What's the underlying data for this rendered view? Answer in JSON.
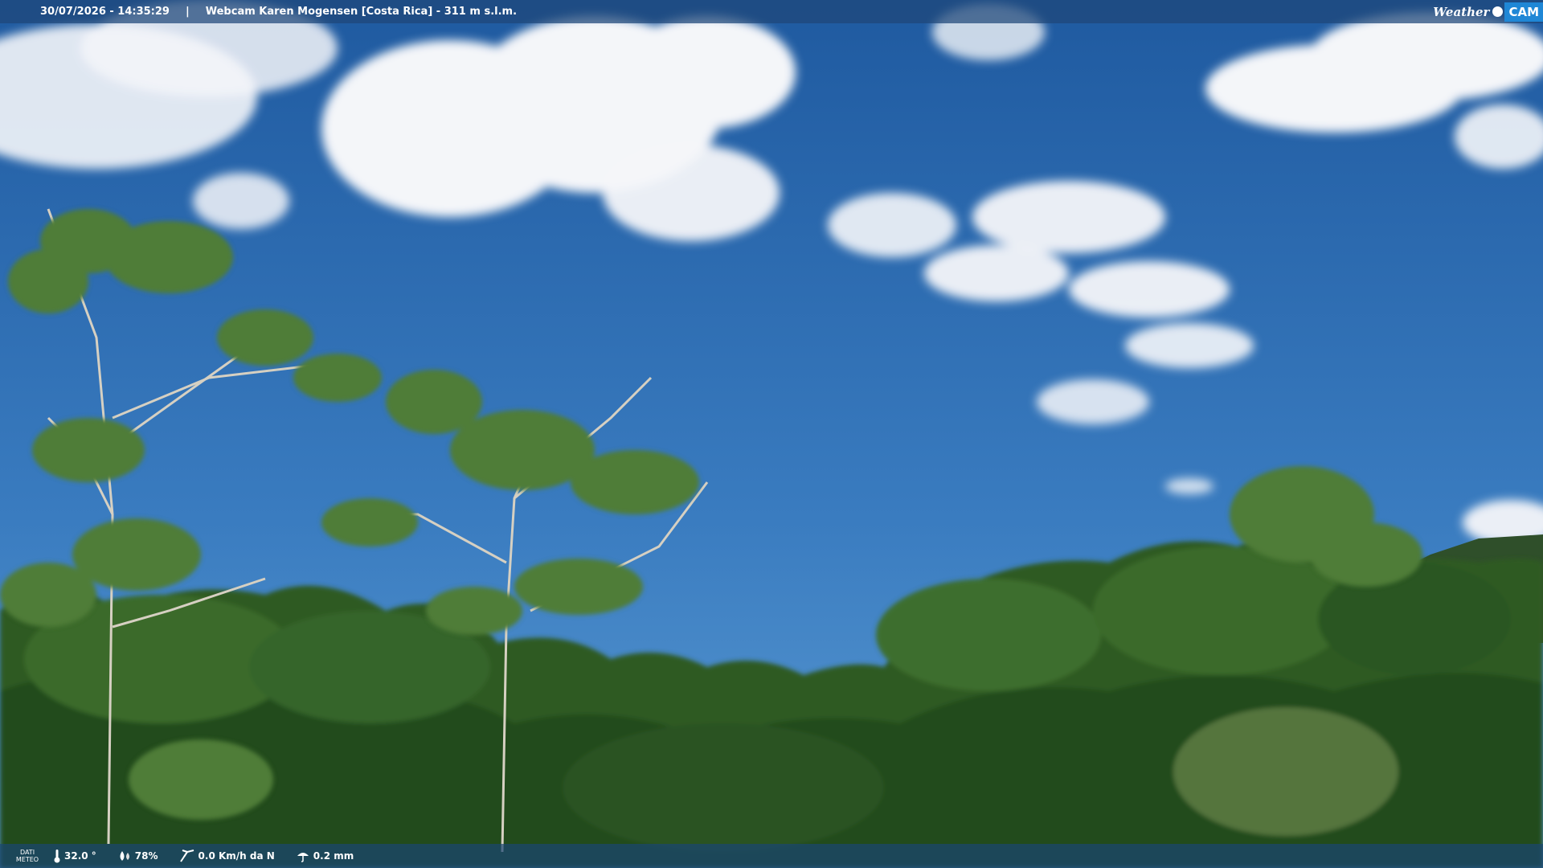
{
  "header": {
    "timestamp": "30/07/2026 - 14:35:29",
    "separator": "|",
    "title": "Webcam Karen Mogensen [Costa Rica]  - 311 m s.l.m."
  },
  "brand": {
    "part1": "Weather",
    "part2": "CAM"
  },
  "meteo": {
    "label_line1": "DATI",
    "label_line2": "METEO",
    "temperature": "32.0 °",
    "humidity": "78%",
    "wind": "0.0 Km/h da N",
    "rain": "0.2 mm"
  },
  "colors": {
    "sky_top": "#1f5aa0",
    "sky_bottom": "#4d8fcd",
    "foliage": "#2f5a22",
    "bar": "#1e4678",
    "brand_accent": "#1f87d6"
  },
  "icons": [
    "thermometer-icon",
    "humidity-icon",
    "wind-icon",
    "rain-icon"
  ]
}
